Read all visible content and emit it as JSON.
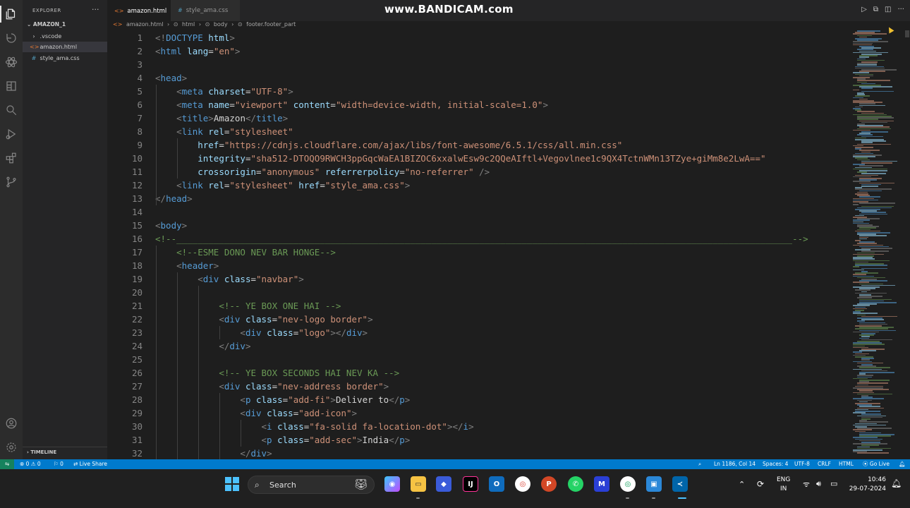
{
  "watermark": "www.BANDICAM.com",
  "explorer": {
    "title": "EXPLORER",
    "more": "···",
    "root": "AMAZON_1",
    "items": [
      {
        "label": ".vscode",
        "glyph": "›"
      },
      {
        "label": "amazon.html",
        "glyph": "<>"
      },
      {
        "label": "style_ama.css",
        "glyph": "#"
      }
    ],
    "timeline": "TIMELINE"
  },
  "tabs": [
    {
      "label": "amazon.html",
      "icon": "<>",
      "close": "✕"
    },
    {
      "label": "style_ama.css",
      "icon": "#"
    }
  ],
  "breadcrumb": [
    "amazon.html",
    "html",
    "body",
    "footer.footer_part"
  ],
  "code": [
    {
      "n": "1",
      "t": [
        [
          "t-br",
          "<!"
        ],
        [
          "t-tag",
          "DOCTYPE"
        ],
        [
          "t-txt",
          " "
        ],
        [
          "t-attr",
          "html"
        ],
        [
          "t-br",
          ">"
        ]
      ]
    },
    {
      "n": "2",
      "t": [
        [
          "t-br",
          "<"
        ],
        [
          "t-tag",
          "html"
        ],
        [
          "t-txt",
          " "
        ],
        [
          "t-attr",
          "lang"
        ],
        [
          "t-txt",
          "="
        ],
        [
          "t-str",
          "\"en\""
        ],
        [
          "t-br",
          ">"
        ]
      ]
    },
    {
      "n": "3",
      "t": []
    },
    {
      "n": "4",
      "t": [
        [
          "t-br",
          "<"
        ],
        [
          "t-tag",
          "head"
        ],
        [
          "t-br",
          ">"
        ]
      ]
    },
    {
      "n": "5",
      "t": [
        [
          "t-txt",
          "    "
        ],
        [
          "t-br",
          "<"
        ],
        [
          "t-tag",
          "meta"
        ],
        [
          "t-txt",
          " "
        ],
        [
          "t-attr",
          "charset"
        ],
        [
          "t-txt",
          "="
        ],
        [
          "t-str",
          "\"UTF-8\""
        ],
        [
          "t-br",
          ">"
        ]
      ]
    },
    {
      "n": "6",
      "t": [
        [
          "t-txt",
          "    "
        ],
        [
          "t-br",
          "<"
        ],
        [
          "t-tag",
          "meta"
        ],
        [
          "t-txt",
          " "
        ],
        [
          "t-attr",
          "name"
        ],
        [
          "t-txt",
          "="
        ],
        [
          "t-str",
          "\"viewport\""
        ],
        [
          "t-txt",
          " "
        ],
        [
          "t-attr",
          "content"
        ],
        [
          "t-txt",
          "="
        ],
        [
          "t-str",
          "\"width=device-width, initial-scale=1.0\""
        ],
        [
          "t-br",
          ">"
        ]
      ]
    },
    {
      "n": "7",
      "t": [
        [
          "t-txt",
          "    "
        ],
        [
          "t-br",
          "<"
        ],
        [
          "t-tag",
          "title"
        ],
        [
          "t-br",
          ">"
        ],
        [
          "t-txt",
          "Amazon"
        ],
        [
          "t-br",
          "</"
        ],
        [
          "t-tag",
          "title"
        ],
        [
          "t-br",
          ">"
        ]
      ]
    },
    {
      "n": "8",
      "t": [
        [
          "t-txt",
          "    "
        ],
        [
          "t-br",
          "<"
        ],
        [
          "t-tag",
          "link"
        ],
        [
          "t-txt",
          " "
        ],
        [
          "t-attr",
          "rel"
        ],
        [
          "t-txt",
          "="
        ],
        [
          "t-str",
          "\"stylesheet\""
        ]
      ]
    },
    {
      "n": "9",
      "t": [
        [
          "t-txt",
          "        "
        ],
        [
          "t-attr",
          "href"
        ],
        [
          "t-txt",
          "="
        ],
        [
          "t-str",
          "\"https://cdnjs.cloudflare.com/ajax/libs/font-awesome/6.5.1/css/all.min.css\""
        ]
      ]
    },
    {
      "n": "10",
      "t": [
        [
          "t-txt",
          "        "
        ],
        [
          "t-attr",
          "integrity"
        ],
        [
          "t-txt",
          "="
        ],
        [
          "t-str",
          "\"sha512-DTOQO9RWCH3ppGqcWaEA1BIZOC6xxalwEsw9c2QQeAIftl+Vegovlnee1c9QX4TctnWMn13TZye+giMm8e2LwA==\""
        ]
      ]
    },
    {
      "n": "11",
      "t": [
        [
          "t-txt",
          "        "
        ],
        [
          "t-attr",
          "crossorigin"
        ],
        [
          "t-txt",
          "="
        ],
        [
          "t-str",
          "\"anonymous\""
        ],
        [
          "t-txt",
          " "
        ],
        [
          "t-attr",
          "referrerpolicy"
        ],
        [
          "t-txt",
          "="
        ],
        [
          "t-str",
          "\"no-referrer\""
        ],
        [
          "t-txt",
          " "
        ],
        [
          "t-br",
          "/>"
        ]
      ]
    },
    {
      "n": "12",
      "t": [
        [
          "t-txt",
          "    "
        ],
        [
          "t-br",
          "<"
        ],
        [
          "t-tag",
          "link"
        ],
        [
          "t-txt",
          " "
        ],
        [
          "t-attr",
          "rel"
        ],
        [
          "t-txt",
          "="
        ],
        [
          "t-str",
          "\"stylesheet\""
        ],
        [
          "t-txt",
          " "
        ],
        [
          "t-attr",
          "href"
        ],
        [
          "t-txt",
          "="
        ],
        [
          "t-str",
          "\"style_ama.css\""
        ],
        [
          "t-br",
          ">"
        ]
      ]
    },
    {
      "n": "13",
      "t": [
        [
          "t-br",
          "</"
        ],
        [
          "t-tag",
          "head"
        ],
        [
          "t-br",
          ">"
        ]
      ]
    },
    {
      "n": "14",
      "t": []
    },
    {
      "n": "15",
      "t": [
        [
          "t-br",
          "<"
        ],
        [
          "t-tag",
          "body"
        ],
        [
          "t-br",
          ">"
        ]
      ]
    },
    {
      "n": "16",
      "t": [
        [
          "t-com",
          "<!--____________________________________________________________________________________________________________________-->"
        ]
      ]
    },
    {
      "n": "17",
      "t": [
        [
          "t-txt",
          "    "
        ],
        [
          "t-com",
          "<!--ESME DONO NEV BAR HONGE-->"
        ]
      ]
    },
    {
      "n": "18",
      "t": [
        [
          "t-txt",
          "    "
        ],
        [
          "t-br",
          "<"
        ],
        [
          "t-tag",
          "header"
        ],
        [
          "t-br",
          ">"
        ]
      ]
    },
    {
      "n": "19",
      "t": [
        [
          "t-txt",
          "        "
        ],
        [
          "t-br",
          "<"
        ],
        [
          "t-tag",
          "div"
        ],
        [
          "t-txt",
          " "
        ],
        [
          "t-attr",
          "class"
        ],
        [
          "t-txt",
          "="
        ],
        [
          "t-str",
          "\"navbar\""
        ],
        [
          "t-br",
          ">"
        ]
      ]
    },
    {
      "n": "20",
      "t": []
    },
    {
      "n": "21",
      "t": [
        [
          "t-txt",
          "            "
        ],
        [
          "t-com",
          "<!-- YE BOX ONE HAI -->"
        ]
      ]
    },
    {
      "n": "22",
      "t": [
        [
          "t-txt",
          "            "
        ],
        [
          "t-br",
          "<"
        ],
        [
          "t-tag",
          "div"
        ],
        [
          "t-txt",
          " "
        ],
        [
          "t-attr",
          "class"
        ],
        [
          "t-txt",
          "="
        ],
        [
          "t-str",
          "\"nev-logo border\""
        ],
        [
          "t-br",
          ">"
        ]
      ]
    },
    {
      "n": "23",
      "t": [
        [
          "t-txt",
          "                "
        ],
        [
          "t-br",
          "<"
        ],
        [
          "t-tag",
          "div"
        ],
        [
          "t-txt",
          " "
        ],
        [
          "t-attr",
          "class"
        ],
        [
          "t-txt",
          "="
        ],
        [
          "t-str",
          "\"logo\""
        ],
        [
          "t-br",
          "></"
        ],
        [
          "t-tag",
          "div"
        ],
        [
          "t-br",
          ">"
        ]
      ]
    },
    {
      "n": "24",
      "t": [
        [
          "t-txt",
          "            "
        ],
        [
          "t-br",
          "</"
        ],
        [
          "t-tag",
          "div"
        ],
        [
          "t-br",
          ">"
        ]
      ]
    },
    {
      "n": "25",
      "t": []
    },
    {
      "n": "26",
      "t": [
        [
          "t-txt",
          "            "
        ],
        [
          "t-com",
          "<!-- YE BOX SECONDS HAI NEV KA -->"
        ]
      ]
    },
    {
      "n": "27",
      "t": [
        [
          "t-txt",
          "            "
        ],
        [
          "t-br",
          "<"
        ],
        [
          "t-tag",
          "div"
        ],
        [
          "t-txt",
          " "
        ],
        [
          "t-attr",
          "class"
        ],
        [
          "t-txt",
          "="
        ],
        [
          "t-str",
          "\"nev-address border\""
        ],
        [
          "t-br",
          ">"
        ]
      ]
    },
    {
      "n": "28",
      "t": [
        [
          "t-txt",
          "                "
        ],
        [
          "t-br",
          "<"
        ],
        [
          "t-tag",
          "p"
        ],
        [
          "t-txt",
          " "
        ],
        [
          "t-attr",
          "class"
        ],
        [
          "t-txt",
          "="
        ],
        [
          "t-str",
          "\"add-fi\""
        ],
        [
          "t-br",
          ">"
        ],
        [
          "t-txt",
          "Deliver to"
        ],
        [
          "t-br",
          "</"
        ],
        [
          "t-tag",
          "p"
        ],
        [
          "t-br",
          ">"
        ]
      ]
    },
    {
      "n": "29",
      "t": [
        [
          "t-txt",
          "                "
        ],
        [
          "t-br",
          "<"
        ],
        [
          "t-tag",
          "div"
        ],
        [
          "t-txt",
          " "
        ],
        [
          "t-attr",
          "class"
        ],
        [
          "t-txt",
          "="
        ],
        [
          "t-str",
          "\"add-icon\""
        ],
        [
          "t-br",
          ">"
        ]
      ]
    },
    {
      "n": "30",
      "t": [
        [
          "t-txt",
          "                    "
        ],
        [
          "t-br",
          "<"
        ],
        [
          "t-tag",
          "i"
        ],
        [
          "t-txt",
          " "
        ],
        [
          "t-attr",
          "class"
        ],
        [
          "t-txt",
          "="
        ],
        [
          "t-str",
          "\"fa-solid fa-location-dot\""
        ],
        [
          "t-br",
          "></"
        ],
        [
          "t-tag",
          "i"
        ],
        [
          "t-br",
          ">"
        ]
      ]
    },
    {
      "n": "31",
      "t": [
        [
          "t-txt",
          "                    "
        ],
        [
          "t-br",
          "<"
        ],
        [
          "t-tag",
          "p"
        ],
        [
          "t-txt",
          " "
        ],
        [
          "t-attr",
          "class"
        ],
        [
          "t-txt",
          "="
        ],
        [
          "t-str",
          "\"add-sec\""
        ],
        [
          "t-br",
          ">"
        ],
        [
          "t-txt",
          "India"
        ],
        [
          "t-br",
          "</"
        ],
        [
          "t-tag",
          "p"
        ],
        [
          "t-br",
          ">"
        ]
      ]
    },
    {
      "n": "32",
      "t": [
        [
          "t-txt",
          "                "
        ],
        [
          "t-br",
          "</"
        ],
        [
          "t-tag",
          "div"
        ],
        [
          "t-br",
          ">"
        ]
      ]
    }
  ],
  "statusbar": {
    "errors": "⊗ 0 ⚠ 0",
    "ports": "⚐ 0",
    "live_share": "Live Share",
    "position": "Ln 1186, Col 14",
    "spaces": "Spaces: 4",
    "encoding": "UTF-8",
    "eol": "CRLF",
    "language": "HTML",
    "go_live": "Go Live"
  },
  "taskbar": {
    "search_label": "Search",
    "lang_top": "ENG",
    "lang_bottom": "IN",
    "time": "10:46",
    "date": "29-07-2024"
  }
}
